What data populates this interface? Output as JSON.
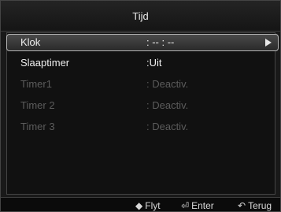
{
  "menu": {
    "title": "Tijd",
    "items": [
      {
        "label": "Klok",
        "value": ": -- : --",
        "selected": true,
        "enabled": true
      },
      {
        "label": "Slaaptimer",
        "value": ":Uit",
        "selected": false,
        "enabled": true
      },
      {
        "label": "Timer1",
        "value": ": Deactiv.",
        "selected": false,
        "enabled": false
      },
      {
        "label": "Timer 2",
        "value": ": Deactiv.",
        "selected": false,
        "enabled": false
      },
      {
        "label": "Timer 3",
        "value": ": Deactiv.",
        "selected": false,
        "enabled": false
      }
    ]
  },
  "footer": {
    "move_icon": "up-down-icon",
    "move_label": "Flyt",
    "enter_icon": "enter-icon",
    "enter_label": "Enter",
    "back_icon": "return-icon",
    "back_label": "Terug"
  },
  "colors": {
    "background": "#191919",
    "text_active": "#f0f0f0",
    "text_disabled": "#5c5c5c",
    "selection_border": "#b5b5b5"
  }
}
